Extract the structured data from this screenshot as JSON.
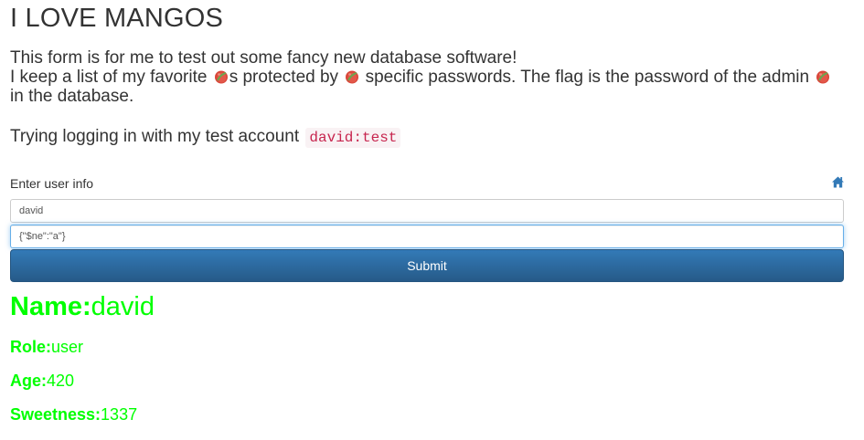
{
  "page": {
    "title": "I LOVE MANGOS"
  },
  "intro": {
    "line1": "This form is for me to test out some fancy new database software!",
    "line2_part1": "I keep a list of my favorite ",
    "line2_part2": "s protected by ",
    "line2_part3": " specific passwords. The flag is the password of the admin ",
    "line3": "in the database.",
    "trying_text": "Trying logging in with my test account",
    "test_account_code": "david:test"
  },
  "form": {
    "heading": "Enter user info",
    "home_icon": "home-icon",
    "username_value": "david",
    "password_value": "{\"$ne\":\"a\"}",
    "submit_label": "Submit",
    "focus_color": "#66afe9",
    "button_color": "#337ab7"
  },
  "result": {
    "name_label": "Name:",
    "name_value": "david",
    "role_label": "Role:",
    "role_value": "user",
    "age_label": "Age:",
    "age_value": "420",
    "sweetness_label": "Sweetness:",
    "sweetness_value": "1337",
    "color": "#00ff00"
  },
  "icons": {
    "mango": "mango-icon"
  }
}
